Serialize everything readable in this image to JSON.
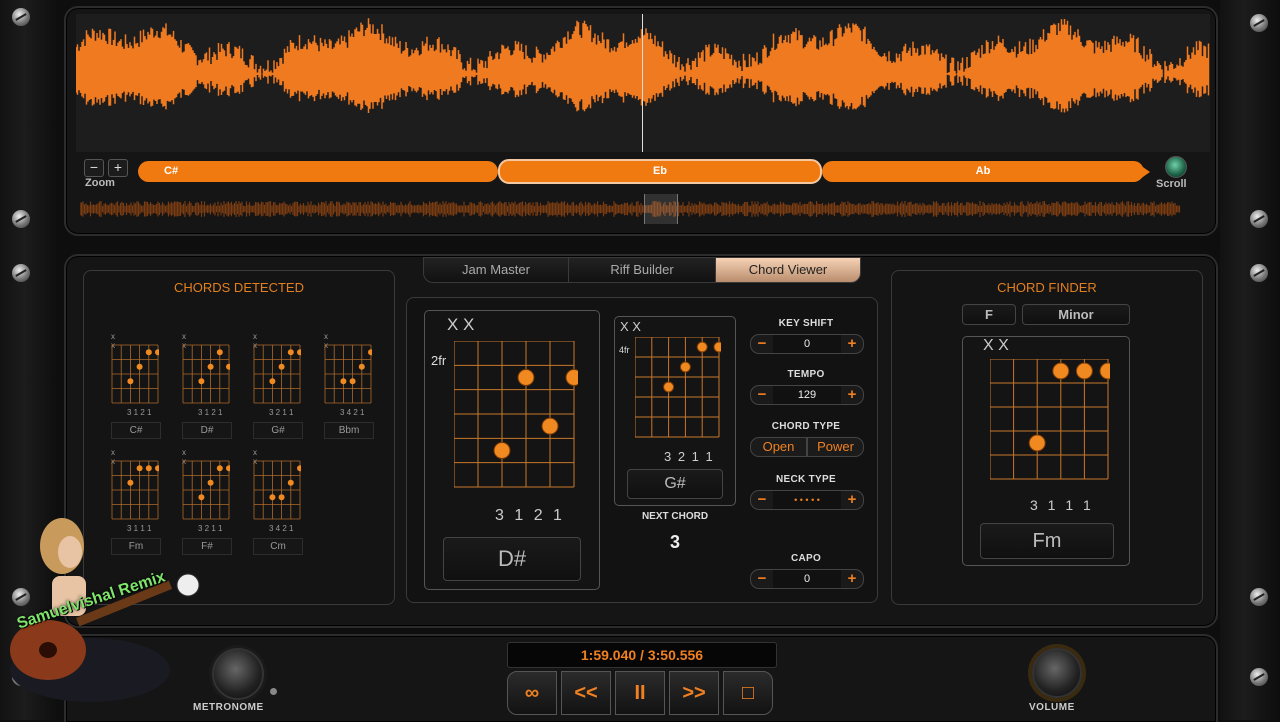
{
  "waveform": {
    "zoom_label": "Zoom",
    "zoom_minus": "−",
    "zoom_plus": "+",
    "scroll_label": "Scroll",
    "segments": [
      {
        "label": "C#",
        "selected": false
      },
      {
        "label": "Eb",
        "selected": true
      },
      {
        "label": "Ab",
        "selected": false
      }
    ],
    "accent_color": "#f07a10"
  },
  "tabs": [
    {
      "label": "Jam Master",
      "active": false
    },
    {
      "label": "Riff Builder",
      "active": false
    },
    {
      "label": "Chord Viewer",
      "active": true
    }
  ],
  "chords_detected": {
    "title": "CHORDS DETECTED",
    "items": [
      {
        "name": "C#",
        "fingers": "3 1 2 1"
      },
      {
        "name": "D#",
        "fingers": "3 1 2 1"
      },
      {
        "name": "G#",
        "fingers": "3 2 1 1"
      },
      {
        "name": "Bbm",
        "fingers": "3 4 2 1"
      },
      {
        "name": "Fm",
        "fingers": "3 1 1 1"
      },
      {
        "name": "F#",
        "fingers": "3 2 1 1"
      },
      {
        "name": "Cm",
        "fingers": "3 4 2 1"
      }
    ]
  },
  "current_chord": {
    "mutes": "X X",
    "fret_label": "2fr",
    "fingers": "3 1 2 1",
    "name": "D#"
  },
  "next_chord": {
    "mutes": "X X",
    "fret_label": "4fr",
    "fingers": "3 2 1 1",
    "name": "G#",
    "label": "NEXT CHORD",
    "countdown": "3"
  },
  "controls": {
    "key_shift": {
      "label": "KEY SHIFT",
      "value": "0"
    },
    "tempo": {
      "label": "TEMPO",
      "value": "129"
    },
    "chord_type": {
      "label": "CHORD TYPE",
      "options": [
        "Open",
        "Power"
      ]
    },
    "neck_type": {
      "label": "NECK TYPE",
      "value": "• • • • •"
    },
    "capo": {
      "label": "CAPO",
      "value": "0"
    },
    "minus": "−",
    "plus": "+"
  },
  "chord_finder": {
    "title": "CHORD FINDER",
    "root": "F",
    "quality": "Minor",
    "mutes": "X X",
    "fingers": "3 1 1 1",
    "name": "Fm"
  },
  "transport": {
    "time": "1:59.040 / 3:50.556",
    "buttons": [
      "∞",
      "<<",
      "II",
      ">>",
      "□"
    ],
    "metronome_label": "METRONOME",
    "volume_label": "VOLUME"
  },
  "watermark": "Samuelvishal Remix"
}
